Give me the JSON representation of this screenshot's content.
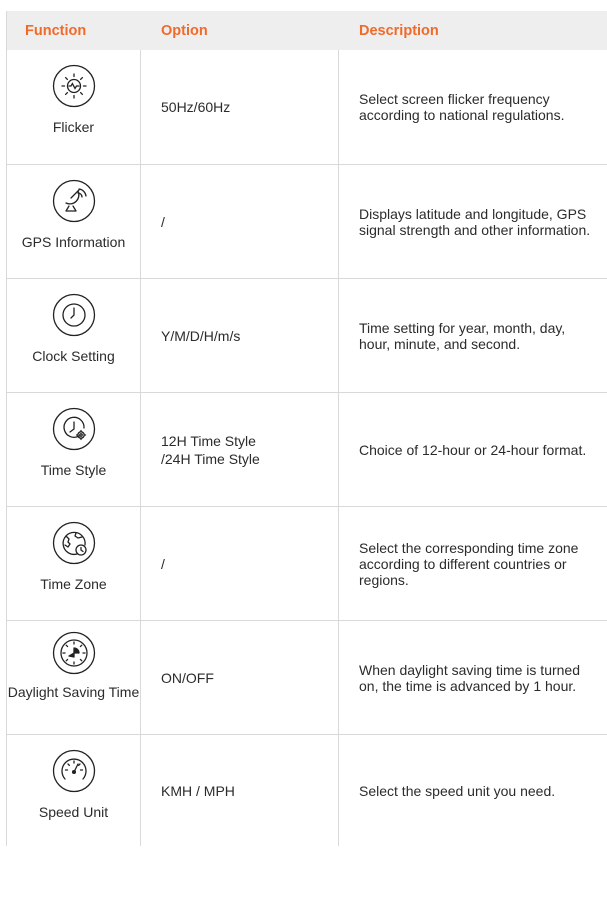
{
  "header": {
    "function": "Function",
    "option": "Option",
    "description": "Description"
  },
  "accent_color": "#f06a2a",
  "rows": [
    {
      "icon": "flicker-icon",
      "function": "Flicker",
      "option": "50Hz/60Hz",
      "description": "Select screen flicker frequency according to national regulations."
    },
    {
      "icon": "gps-satellite-icon",
      "function": "GPS Information",
      "option": "/",
      "description": "Displays latitude and longitude, GPS signal strength and other information."
    },
    {
      "icon": "clock-icon",
      "function": "Clock Setting",
      "option": "Y/M/D/H/m/s",
      "description": "Time setting for year, month, day, hour, minute, and second."
    },
    {
      "icon": "clock-gear-icon",
      "function": "Time Style",
      "option": "12H Time Style\n/24H Time Style",
      "description": "Choice of 12-hour or 24-hour format."
    },
    {
      "icon": "globe-clock-icon",
      "function": "Time Zone",
      "option": "/",
      "description": "Select the corresponding time zone according to different countries or regions."
    },
    {
      "icon": "daylight-saving-icon",
      "function": "Daylight Saving Time",
      "option": "ON/OFF",
      "description": "When daylight saving time is turned on, the time is advanced by 1 hour."
    },
    {
      "icon": "speedometer-icon",
      "function": "Speed Unit",
      "option": "KMH / MPH",
      "description": "Select the speed unit you need."
    }
  ]
}
